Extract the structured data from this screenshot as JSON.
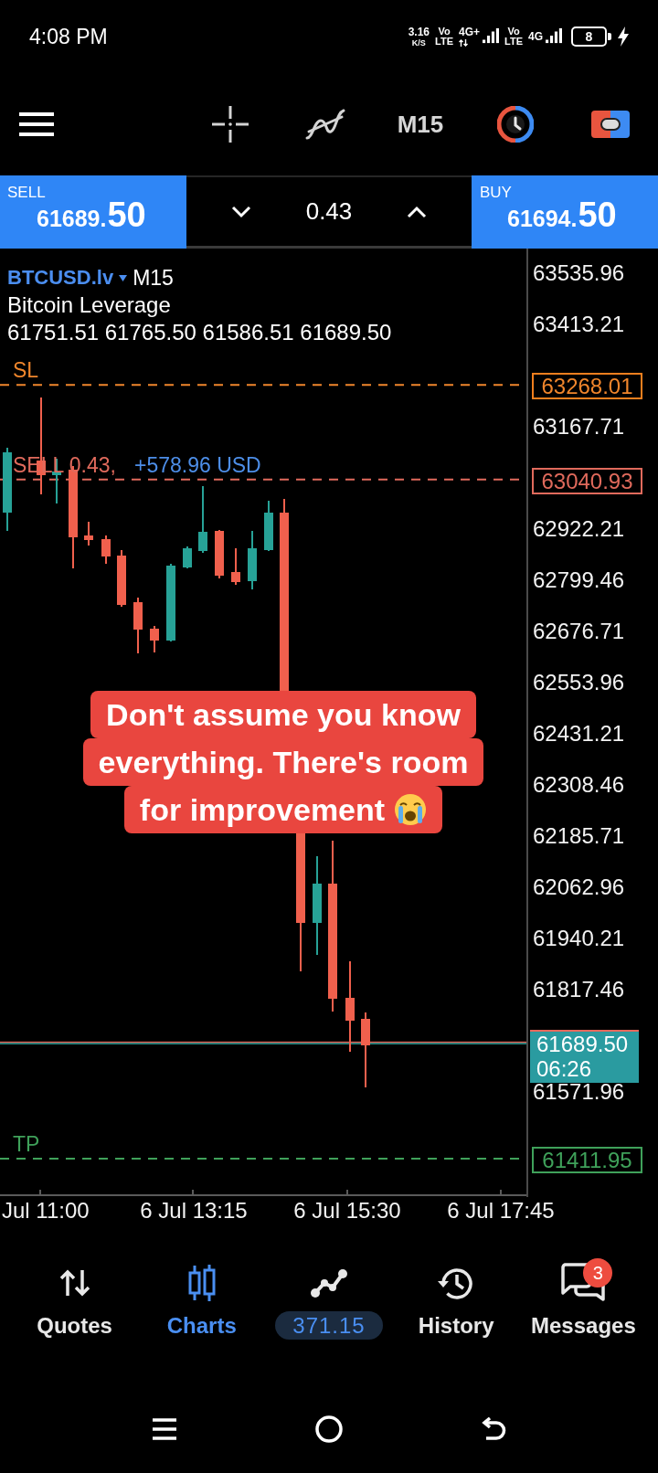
{
  "status_bar": {
    "time": "4:08 PM",
    "net_speed": "3.16",
    "net_unit": "K/S",
    "sims": [
      {
        "volte": "Vo",
        "lte": "LTE",
        "network": "4G+",
        "activity": true
      },
      {
        "volte": "Vo",
        "lte": "LTE",
        "network": "4G",
        "activity": false
      }
    ],
    "battery": "8",
    "charging": true
  },
  "toolbar": {
    "timeframe": "M15"
  },
  "trade_bar": {
    "sell": {
      "label": "SELL",
      "price": "61689.",
      "price_end": "50"
    },
    "volume": "0.43",
    "buy": {
      "label": "BUY",
      "price": "61694.",
      "price_end": "50"
    }
  },
  "chart": {
    "symbol": "BTCUSD.lv",
    "timeframe": "M15",
    "description": "Bitcoin Leverage",
    "ohlc": "61751.51 61765.50 61586.51 61689.50",
    "price_axis": [
      "63535.96",
      "63413.21",
      "63167.71",
      "62922.21",
      "62799.46",
      "62676.71",
      "62553.96",
      "62431.21",
      "62308.46",
      "62185.71",
      "62062.96",
      "61940.21",
      "61817.46",
      "61571.96"
    ],
    "levels": [
      {
        "kind": "sl",
        "label": "SL",
        "price": "63268.01"
      },
      {
        "kind": "position",
        "label": "SELL 0.43,",
        "profit": "+578.96 USD",
        "price": "63040.93"
      },
      {
        "kind": "tp",
        "label": "TP",
        "price": "61411.95"
      }
    ],
    "current": {
      "price": "61689.50",
      "countdown": "06:26"
    },
    "time_axis": [
      "Jul 11:00",
      "6 Jul 13:15",
      "6 Jul 15:30",
      "6 Jul 17:45"
    ]
  },
  "caption": [
    {
      "text": "Don't assume you know",
      "emoji": false
    },
    {
      "text": "everything. There's room",
      "emoji": false
    },
    {
      "text": "for improvement",
      "emoji": true
    }
  ],
  "bottom_nav": [
    {
      "kind": "quotes",
      "label": "Quotes",
      "selected": false
    },
    {
      "kind": "charts",
      "label": "Charts",
      "selected": true
    },
    {
      "kind": "trade",
      "label": "371.15",
      "selected": false
    },
    {
      "kind": "history",
      "label": "History",
      "selected": false
    },
    {
      "kind": "messages",
      "label": "Messages",
      "selected": false,
      "badge": "3"
    }
  ]
}
